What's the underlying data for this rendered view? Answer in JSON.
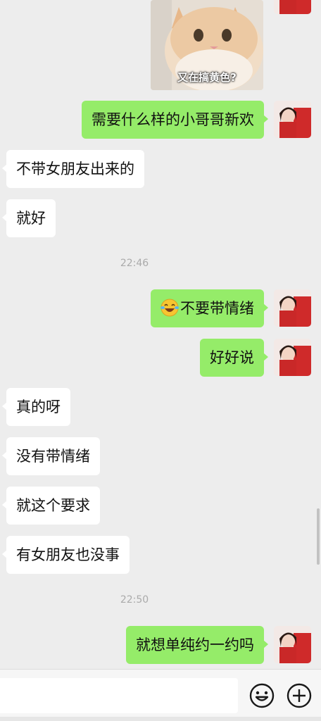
{
  "sticker": {
    "caption": "又在搞黄色?"
  },
  "messages": [
    {
      "text": "需要什么样的小哥哥新欢"
    },
    {
      "text": "不带女朋友出来的"
    },
    {
      "text": "就好"
    },
    {
      "text": "不要带情绪",
      "icon": "laughing-tears-emoji-icon"
    },
    {
      "text": "好好说"
    },
    {
      "text": "真的呀"
    },
    {
      "text": "没有带情绪"
    },
    {
      "text": "就这个要求"
    },
    {
      "text": "有女朋友也没事"
    },
    {
      "text": "就想单纯约一约吗"
    }
  ],
  "timestamps": [
    "22:46",
    "22:50"
  ],
  "input": {
    "value": "",
    "placeholder": ""
  },
  "colors": {
    "outgoing": "#95ec69",
    "incoming": "#ffffff",
    "background": "#ededed"
  },
  "icons": {
    "emoji": "smiley-face-icon",
    "more": "plus-circle-icon"
  }
}
